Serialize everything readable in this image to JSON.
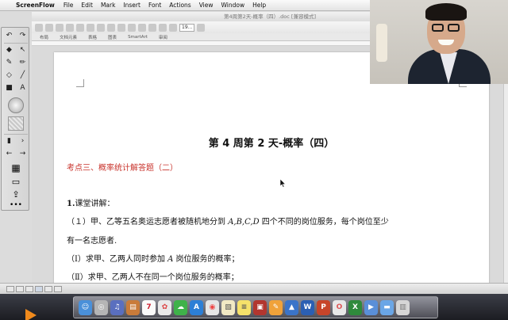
{
  "menubar": {
    "app_name": "ScreenFlow",
    "items": [
      "File",
      "Edit",
      "Mark",
      "Insert",
      "Font",
      "Actions",
      "View",
      "Window",
      "Help"
    ]
  },
  "window": {
    "title": "第4周第2天-概率（四）.doc [兼容模式]",
    "zoom": "19...",
    "ribbon_tabs": [
      "布局",
      "文档元素",
      "表格",
      "图表",
      "SmartArt",
      "审阅"
    ]
  },
  "document": {
    "title": "第 4 周第 2 天-概率（四）",
    "section_heading": "考点三、概率统计解答题（二）",
    "lesson_heading_number": "1.",
    "lesson_heading_text": "课堂讲解：",
    "problem_line1_prefix": "（１）甲、乙等五名奥运志愿者被随机地分到 ",
    "problem_line1_math": "A,B,C,D",
    "problem_line1_suffix": " 四个不同的岗位服务，每个岗位至少",
    "problem_line2": "有一名志愿者.",
    "q1_prefix": "（Ⅰ）求甲、乙两人同时参加 ",
    "q1_math": "A",
    "q1_suffix": " 岗位服务的概率；",
    "q2": "（Ⅱ）求甲、乙两人不在同一个岗位服务的概率；"
  },
  "palette": {
    "icons": [
      "back-arrow-icon",
      "forward-arrow-icon",
      "fill-bucket-icon",
      "arrow-select-icon",
      "pencil-icon",
      "brush-icon",
      "eraser-icon",
      "line-icon",
      "shapes-icon",
      "text-icon",
      "color-wheel-icon",
      "pattern-icon",
      "document-icon",
      "navigate-icon",
      "grid-icon",
      "screen-icon",
      "share-icon",
      "more-icon"
    ]
  },
  "colors": {
    "section_heading": "#c8322b",
    "dock_bg": "#9a9aa6"
  },
  "dock": {
    "icons": [
      "finder-icon",
      "safari-icon",
      "itunes-icon",
      "books-icon",
      "calendar-icon",
      "photos-icon",
      "messages-icon",
      "appstore-icon",
      "chrome-icon",
      "preview-icon",
      "notes-icon",
      "photobooth-icon",
      "pages-icon",
      "keynote-icon",
      "word-icon",
      "powerpoint-icon",
      "excel-icon",
      "screenflow-icon",
      "downloads-folder-icon",
      "trash-icon"
    ]
  }
}
